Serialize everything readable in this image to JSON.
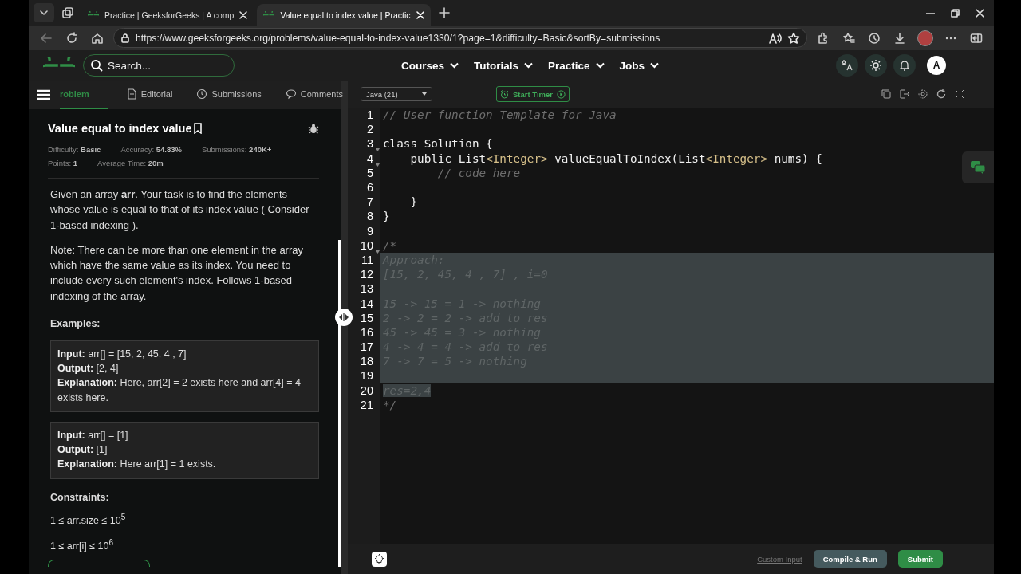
{
  "browser": {
    "tabs": [
      {
        "title": "Practice | GeeksforGeeks | A comp",
        "selected": false
      },
      {
        "title": "Value equal to index value | Practic",
        "selected": true
      }
    ],
    "url": "https://www.geeksforgeeks.org/problems/value-equal-to-index-value1330/1?page=1&difficulty=Basic&sortBy=submissions"
  },
  "header": {
    "search_placeholder": "Search...",
    "nav": [
      "Courses",
      "Tutorials",
      "Practice",
      "Jobs"
    ],
    "avatar": "A"
  },
  "problem_tabs": [
    {
      "label": "roblem",
      "kind": "problem",
      "selected": true
    },
    {
      "label": "Editorial",
      "kind": "editorial",
      "selected": false
    },
    {
      "label": "Submissions",
      "kind": "submissions",
      "selected": false
    },
    {
      "label": "Comments",
      "kind": "comments",
      "selected": false
    }
  ],
  "problem": {
    "title": "Value equal to index value",
    "meta": [
      [
        {
          "label": "Difficulty:",
          "value": "Basic"
        },
        {
          "label": "Accuracy:",
          "value": "54.83%"
        },
        {
          "label": "Submissions:",
          "value": "240K+"
        }
      ],
      [
        {
          "label": "Points:",
          "value": "1"
        },
        {
          "label": "Average Time:",
          "value": "20m"
        }
      ]
    ],
    "paragraphs": [
      "Given an array **arr**. Your task is to find the elements whose value is equal to that of its index value ( Consider 1-based indexing ).",
      "Note: There can be more than one element in the array which have the same value as its index. You need to include every such element's index. Follows 1-based indexing of the array."
    ],
    "examples_heading": "Examples:",
    "examples": [
      {
        "lines": [
          "**Input:** arr[] = [15, 2, 45, 4 , 7]",
          "**Output:** [2, 4]",
          "**Explanation:** Here, arr[2] = 2 exists here and arr[4] = 4 exists here."
        ]
      },
      {
        "lines": [
          "**Input:** arr[] = [1]",
          "**Output:** [1]",
          "**Explanation:** Here arr[1] = 1 exists."
        ]
      }
    ],
    "constraints_heading": "Constraints:",
    "constraints": [
      "1 ≤ arr.size ≤ 10$^{5}$",
      "1 ≤ arr[i] ≤ 10$^{6}$"
    ]
  },
  "editor": {
    "language": "Java (21)",
    "timer": "Start Timer",
    "lines": [
      {
        "number": "1",
        "selected": false,
        "foldable": false,
        "tokens": [
          {
            "kind": "comment",
            "text": "// User function Template for Java"
          }
        ]
      },
      {
        "number": "2",
        "selected": false,
        "foldable": false
      },
      {
        "number": "3",
        "selected": false,
        "foldable": true,
        "tokens": [
          {
            "kind": "code",
            "text": "class Solution {"
          }
        ]
      },
      {
        "number": "4",
        "selected": false,
        "foldable": true,
        "tokens": [
          {
            "kind": "code",
            "text": "    public List"
          },
          {
            "kind": "type",
            "text": "<Integer>"
          },
          {
            "kind": "code",
            "text": " valueEqualToIndex(List"
          },
          {
            "kind": "type",
            "text": "<Integer>"
          },
          {
            "kind": "code",
            "text": " nums) {"
          }
        ]
      },
      {
        "number": "5",
        "selected": false,
        "foldable": false,
        "tokens": [
          {
            "kind": "comment",
            "text": "        // code here"
          }
        ]
      },
      {
        "number": "6",
        "selected": false,
        "foldable": false
      },
      {
        "number": "7",
        "selected": false,
        "foldable": false,
        "tokens": [
          {
            "kind": "code",
            "text": "    }"
          }
        ]
      },
      {
        "number": "8",
        "selected": false,
        "foldable": false,
        "tokens": [
          {
            "kind": "code",
            "text": "}"
          }
        ]
      },
      {
        "number": "9",
        "selected": false,
        "foldable": false
      },
      {
        "number": "10",
        "selected": false,
        "foldable": true,
        "tokens": [
          {
            "kind": "comment",
            "text": "/*"
          }
        ]
      },
      {
        "number": "11",
        "selected": true,
        "foldable": false,
        "tokens": [
          {
            "kind": "comment",
            "text": "Approach:"
          }
        ]
      },
      {
        "number": "12",
        "selected": true,
        "foldable": false,
        "tokens": [
          {
            "kind": "comment",
            "text": "[15, 2, 45, 4 , 7] , i=0"
          }
        ]
      },
      {
        "number": "13",
        "selected": true,
        "foldable": false
      },
      {
        "number": "14",
        "selected": true,
        "foldable": false,
        "tokens": [
          {
            "kind": "comment",
            "text": "15 -> 15 = 1 -> nothing"
          }
        ]
      },
      {
        "number": "15",
        "selected": true,
        "foldable": false,
        "tokens": [
          {
            "kind": "comment",
            "text": "2 -> 2 = 2 -> add to res"
          }
        ]
      },
      {
        "number": "16",
        "selected": true,
        "foldable": false,
        "tokens": [
          {
            "kind": "comment",
            "text": "45 -> 45 = 3 -> nothing"
          }
        ]
      },
      {
        "number": "17",
        "selected": true,
        "foldable": false,
        "tokens": [
          {
            "kind": "comment",
            "text": "4 -> 4 = 4 -> add to res"
          }
        ]
      },
      {
        "number": "18",
        "selected": true,
        "foldable": false,
        "tokens": [
          {
            "kind": "comment",
            "text": "7 -> 7 = 5 -> nothing"
          }
        ]
      },
      {
        "number": "19",
        "selected": true,
        "foldable": false
      },
      {
        "number": "20",
        "selected": true,
        "foldable": false,
        "tokens": [
          {
            "kind": "comment",
            "text": "res=2,4"
          }
        ]
      },
      {
        "number": "21",
        "selected": false,
        "foldable": false,
        "tokens": [
          {
            "kind": "comment",
            "text": "*/"
          }
        ]
      }
    ],
    "custom_input": "Custom Input",
    "compile": "Compile & Run",
    "submit": "Submit"
  }
}
